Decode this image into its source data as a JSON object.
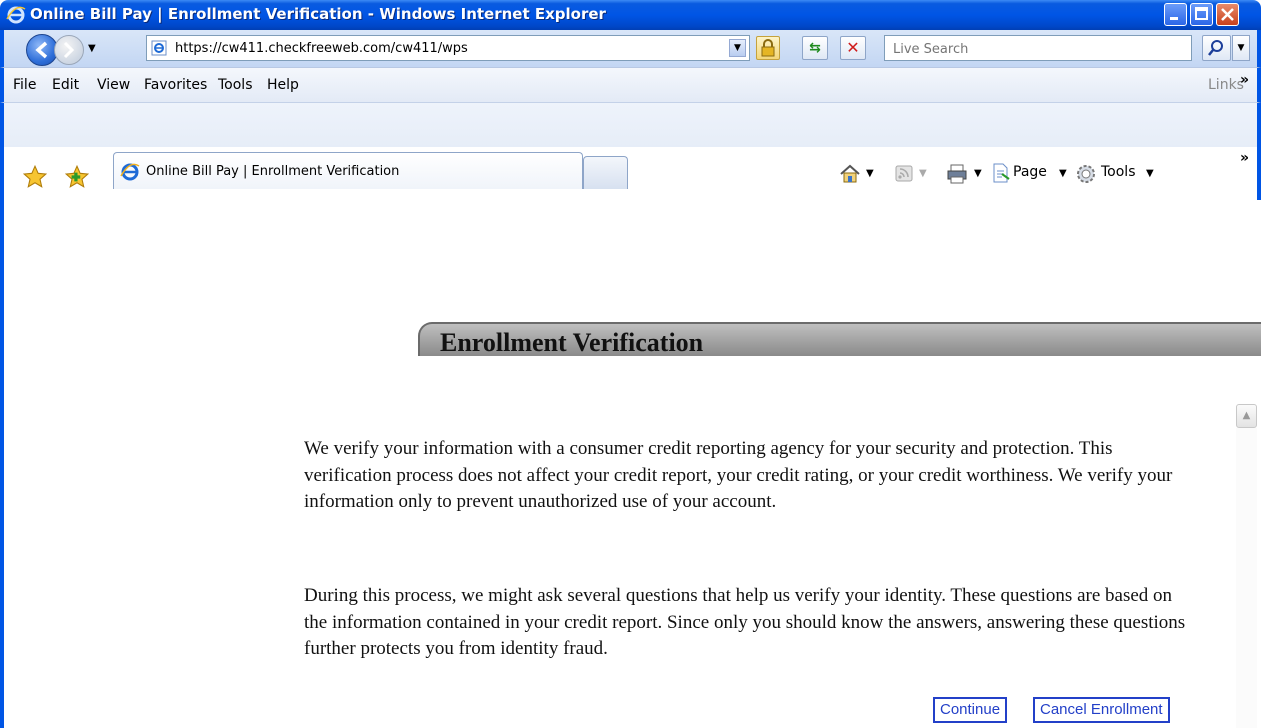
{
  "window": {
    "title": "Online Bill Pay | Enrollment Verification - Windows Internet Explorer"
  },
  "address_bar": {
    "url": "https://cw411.checkfreeweb.com/cw411/wps",
    "search_placeholder": "Live Search"
  },
  "menu": {
    "items": [
      "File",
      "Edit",
      "View",
      "Favorites",
      "Tools",
      "Help"
    ],
    "links_label": "Links"
  },
  "tabs": {
    "active_label": "Online Bill Pay | Enrollment Verification"
  },
  "command_bar": {
    "page_label": "Page",
    "tools_label": "Tools"
  },
  "page": {
    "heading": "Enrollment Verification",
    "paragraph1": "We verify your information with a consumer credit reporting agency for your security and protection. This verification process does not affect your credit report, your credit rating, or your credit worthiness. We verify your information only to prevent unauthorized use of your account.",
    "paragraph2": "During this process, we might ask several questions that help us verify your identity. These questions are based on the information contained in your credit report. Since only you should know the answers, answering these questions further protects you from identity fraud.",
    "continue_label": "Continue",
    "cancel_label": "Cancel Enrollment"
  }
}
